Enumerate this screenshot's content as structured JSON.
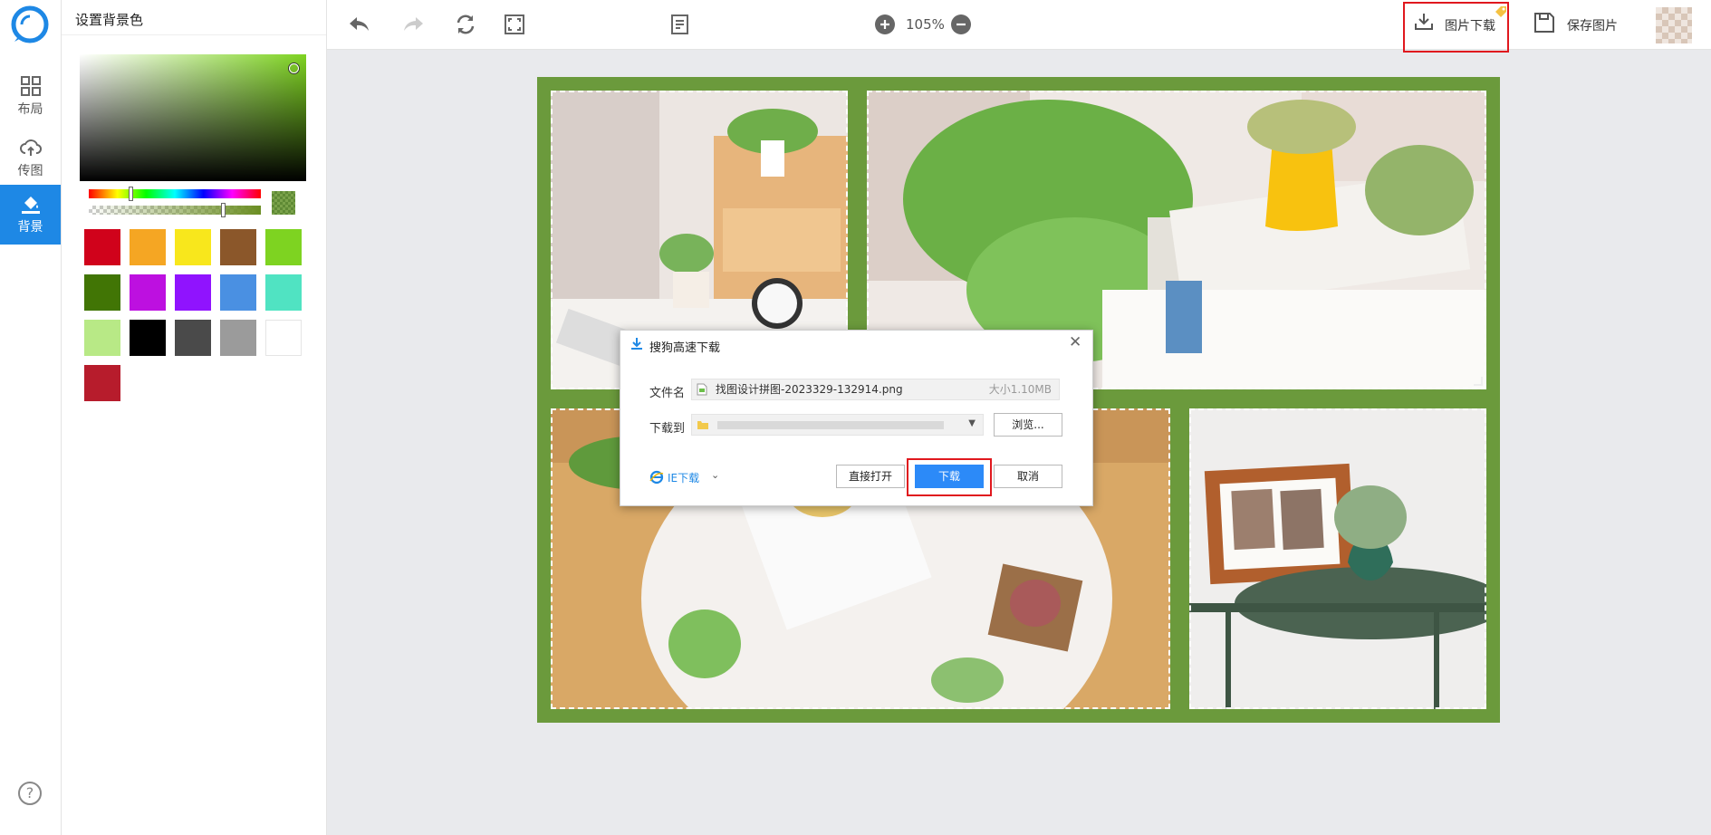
{
  "left_nav": {
    "items": [
      {
        "label": "布局",
        "icon": "layout-grid-icon"
      },
      {
        "label": "传图",
        "icon": "cloud-upload-icon"
      },
      {
        "label": "背景",
        "icon": "paint-bucket-icon",
        "active": true
      }
    ],
    "help_label": "?"
  },
  "panel": {
    "title": "设置背景色",
    "swatches": [
      "#d0021b",
      "#f5a623",
      "#f8e71c",
      "#8b572a",
      "#7ed321",
      "#417505",
      "#bd10e0",
      "#9013fe",
      "#4a90e2",
      "#50e3c2",
      "#b8e986",
      "#000000",
      "#4a4a4a",
      "#9b9b9b",
      "#ffffff",
      "#b71c2c"
    ],
    "selected_color": "#6b8e23"
  },
  "toolbar": {
    "zoom": "105%",
    "download_label": "图片下载",
    "save_label": "保存图片"
  },
  "canvas": {
    "background_color": "#6b9a3c"
  },
  "dialog": {
    "title": "搜狗高速下载",
    "filename_label": "文件名",
    "filename": "找图设计拼图-2023329-132914.png",
    "size": "大小1.10MB",
    "saveto_label": "下载到",
    "browse_label": "浏览...",
    "ie_label": "IE下载",
    "open_label": "直接打开",
    "download_label": "下载",
    "cancel_label": "取消"
  }
}
